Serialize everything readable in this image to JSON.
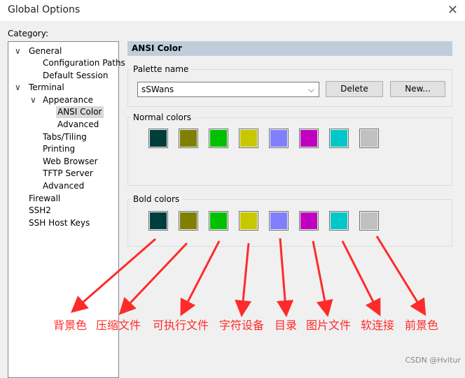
{
  "window": {
    "title": "Global Options",
    "close": "✕"
  },
  "category_label": "Category:",
  "tree": [
    {
      "label": "General",
      "expanded": true
    },
    {
      "label": "Configuration Paths"
    },
    {
      "label": "Default Session"
    },
    {
      "label": "Terminal",
      "expanded": true
    },
    {
      "label": "Appearance",
      "expanded": true
    },
    {
      "label": "ANSI Color",
      "selected": true
    },
    {
      "label": "Advanced"
    },
    {
      "label": "Tabs/Tiling"
    },
    {
      "label": "Printing"
    },
    {
      "label": "Web Browser"
    },
    {
      "label": "TFTP Server"
    },
    {
      "label": "Advanced"
    },
    {
      "label": "Firewall"
    },
    {
      "label": "SSH2"
    },
    {
      "label": "SSH Host Keys"
    }
  ],
  "panel": {
    "title": "ANSI Color",
    "palette_label": "Palette name",
    "palette_value": "sSWans",
    "delete_label": "Delete",
    "new_label": "New...",
    "normal_label": "Normal colors",
    "bold_label": "Bold colors"
  },
  "normal_colors": [
    "#003d3d",
    "#808000",
    "#00c000",
    "#c8c800",
    "#8080ff",
    "#c000c0",
    "#00c8c8",
    "#c0c0c0"
  ],
  "bold_colors": [
    "#003d3d",
    "#808000",
    "#00c000",
    "#c8c800",
    "#8080ff",
    "#c000c0",
    "#00c8c8",
    "#c0c0c0"
  ],
  "annotations": [
    "背景色",
    "压缩文件",
    "可执行文件",
    "字符设备",
    "目录",
    "图片文件",
    "软连接",
    "前景色"
  ],
  "annotation_color": "#ff2a2a",
  "watermark": "CSDN @Hvitur"
}
